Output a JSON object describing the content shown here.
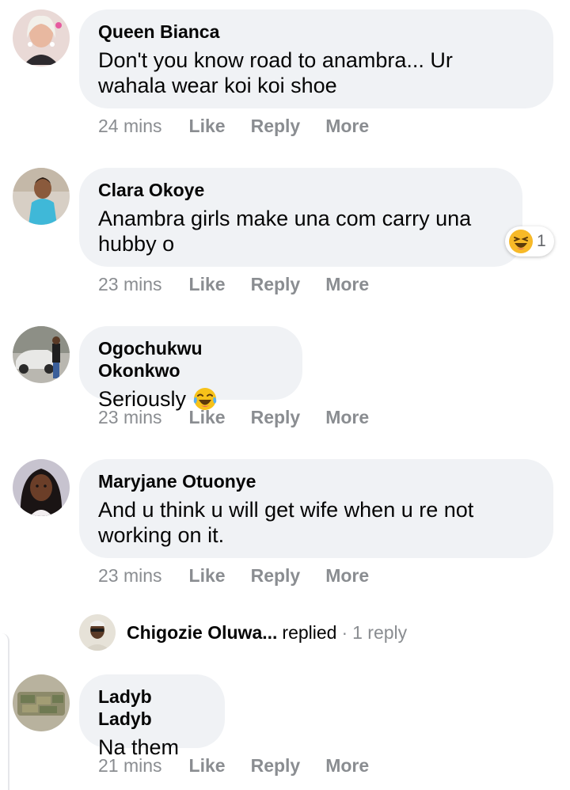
{
  "comments": [
    {
      "author": "Queen Bianca",
      "line1": "Don't you know road to anambra... Ur",
      "line2": "wahala wear koi koi shoe",
      "time": "24 mins"
    },
    {
      "author": "Clara Okoye",
      "line1": "Anambra girls make una com carry una",
      "line2": "hubby o",
      "time": "23 mins",
      "reaction_count": "1",
      "reaction_icon": "laughing-emoji-icon"
    },
    {
      "author": "Ogochukwu Okonkwo",
      "line1": "Seriously",
      "emoji_icon": "tears-of-joy-emoji-icon",
      "time": "23 mins"
    },
    {
      "author": "Maryjane Otuonye",
      "line1": "And u think u will get wife when u re not",
      "line2": "working on it.",
      "time": "23 mins"
    },
    {
      "author": "Ladyb Ladyb",
      "line1": "Na them",
      "time": "21 mins"
    }
  ],
  "actions": {
    "like": "Like",
    "reply": "Reply",
    "more": "More"
  },
  "reply_summary": {
    "name": "Chigozie Oluwa...",
    "verb": "replied",
    "separator": "·",
    "count": "1 reply"
  },
  "colors": {
    "bubble": "#f0f2f5",
    "meta": "#8a8d91",
    "text": "#050505"
  }
}
